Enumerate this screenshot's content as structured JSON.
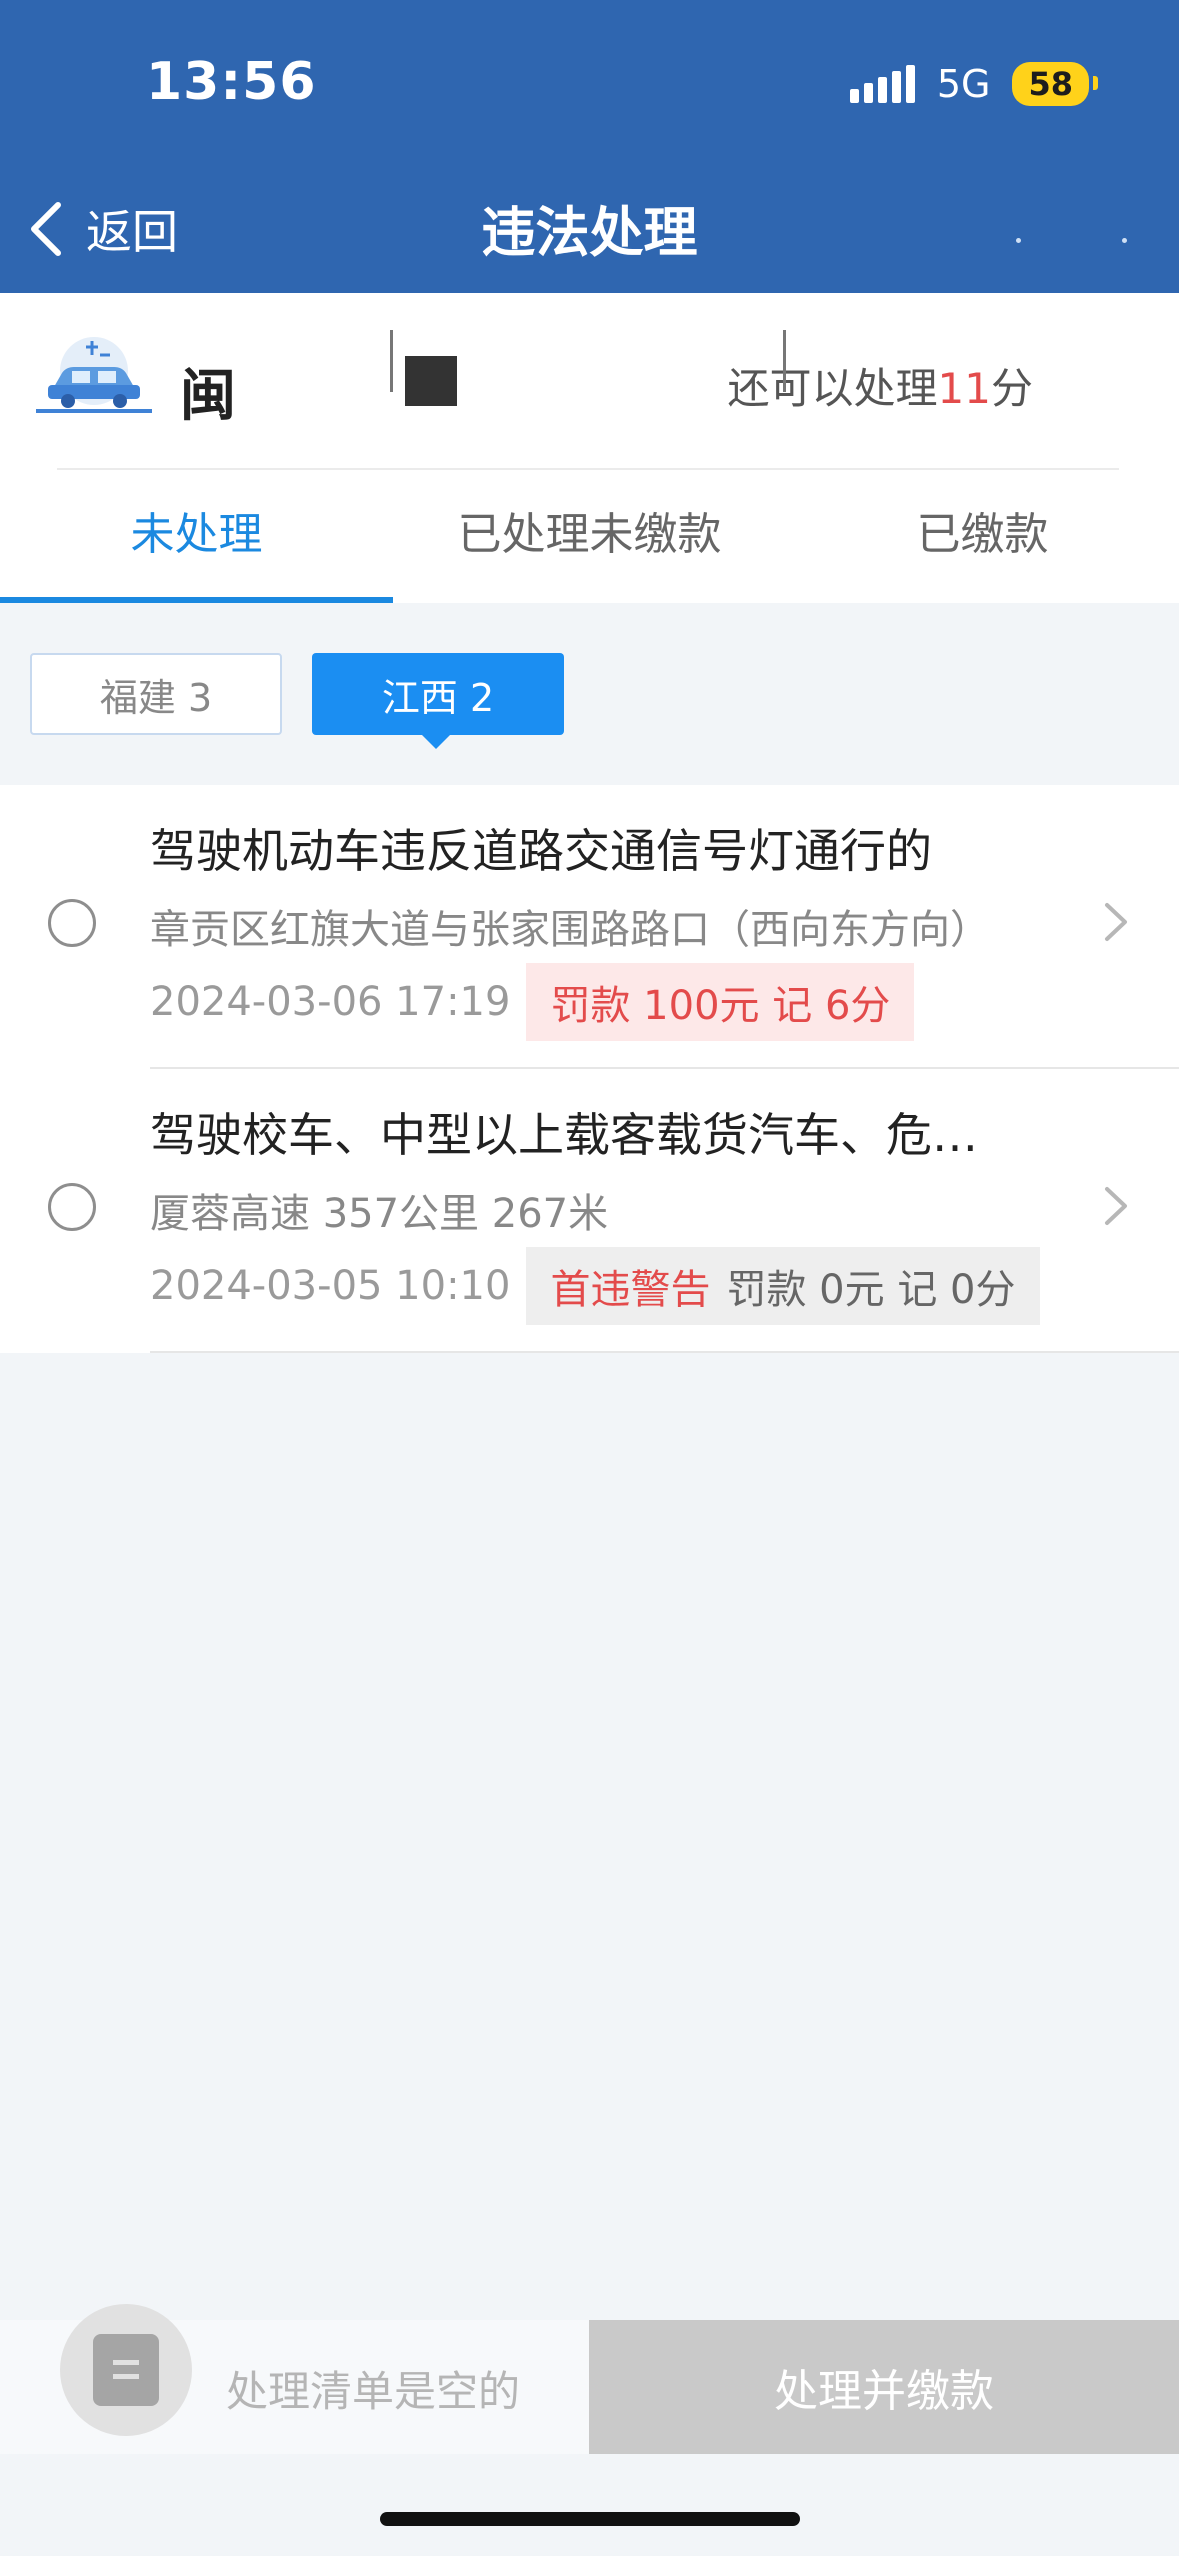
{
  "status": {
    "time": "13:56",
    "network": "5G",
    "battery": "58"
  },
  "nav": {
    "back_label": "返回",
    "title": "违法处理"
  },
  "vehicle": {
    "plate": "闽",
    "points_prefix": "还可以处理",
    "points_value": "11",
    "points_suffix": "分"
  },
  "tabs": [
    {
      "label": "未处理"
    },
    {
      "label": "已处理未缴款"
    },
    {
      "label": "已缴款"
    }
  ],
  "regions": [
    {
      "label": "福建 3"
    },
    {
      "label": "江西 2"
    }
  ],
  "violations": [
    {
      "title": "驾驶机动车违反道路交通信号灯通行的",
      "location": "章贡区红旗大道与张家围路路口（西向东方向）",
      "datetime": "2024-03-06 17:19",
      "penalty": "罚款 100元  记 6分"
    },
    {
      "title": "驾驶校车、中型以上载客载货汽车、危…",
      "location": "厦蓉高速 357公里 267米",
      "datetime": "2024-03-05 10:10",
      "warning": "首违警告",
      "penalty": "罚款 0元  记 0分"
    }
  ],
  "footer": {
    "empty_label": "处理清单是空的",
    "pay_button": "处理并缴款"
  },
  "colors": {
    "header": "#2f66b0",
    "accent": "#1b89e0",
    "alert": "#e34b4b"
  }
}
